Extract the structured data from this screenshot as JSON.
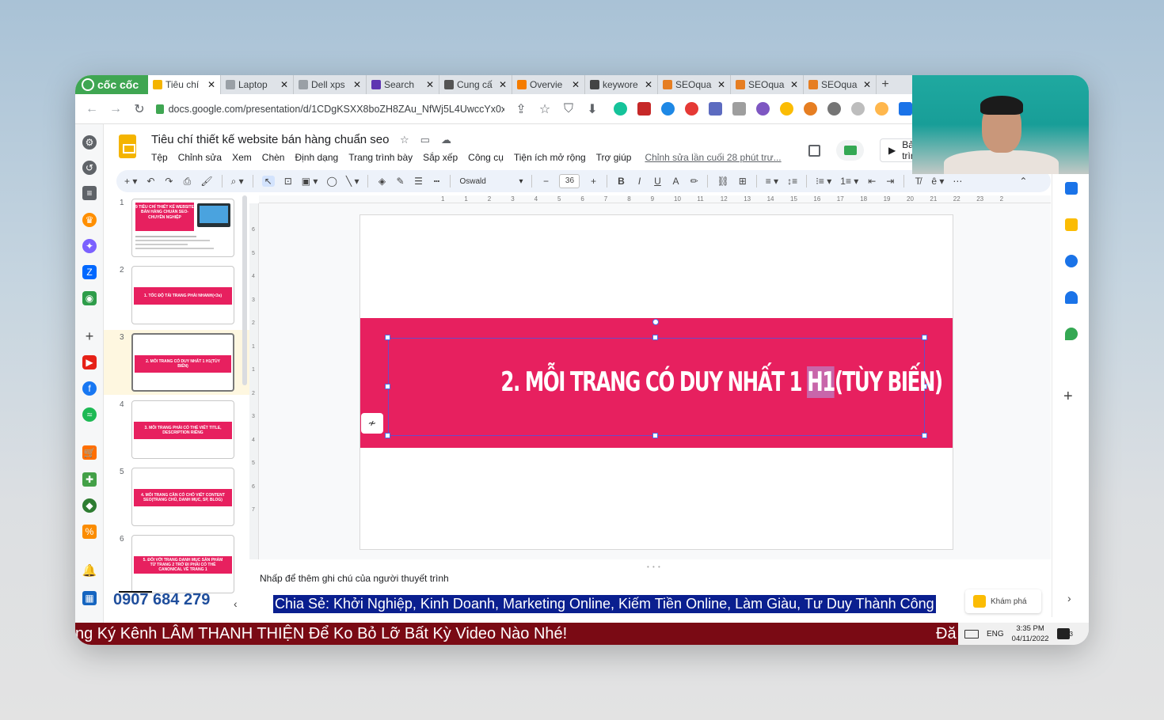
{
  "browser": {
    "brand": "cốc cốc",
    "tabs": [
      {
        "label": "Tiêu chí",
        "icon": "slides-icon",
        "color": "#f4b400",
        "active": true
      },
      {
        "label": "Laptop",
        "icon": "globe-icon",
        "color": "#9aa0a6"
      },
      {
        "label": "Dell xps",
        "icon": "globe-icon",
        "color": "#9aa0a6"
      },
      {
        "label": "Search",
        "icon": "search-console-icon",
        "color": "#5e35b1"
      },
      {
        "label": "Cung cấ",
        "icon": "bing-icon",
        "color": "#555555"
      },
      {
        "label": "Overvie",
        "icon": "ahrefs-icon",
        "color": "#f57c00"
      },
      {
        "label": "keywore",
        "icon": "globe-icon",
        "color": "#444444"
      },
      {
        "label": "SEOqua",
        "icon": "seoquake-icon",
        "color": "#e67e22"
      },
      {
        "label": "SEOqua",
        "icon": "seoquake-icon",
        "color": "#e67e22"
      },
      {
        "label": "SEOqua",
        "icon": "seoquake-icon",
        "color": "#e67e22"
      }
    ],
    "url": "docs.google.com/presentation/d/1CDgKSXX8boZH8ZAu_NfWj5L4UwccYx0xP..."
  },
  "doc": {
    "title": "Tiêu chí thiết kế website bán hàng chuẩn seo",
    "menu": [
      "Tệp",
      "Chỉnh sửa",
      "Xem",
      "Chèn",
      "Định dạng",
      "Trang trình bày",
      "Sắp xếp",
      "Công cụ",
      "Tiện ích mở rộng",
      "Trợ giúp"
    ],
    "last_edit": "Chỉnh sửa lần cuối 28 phút trư...",
    "present_label": "Bản trìn"
  },
  "toolbar": {
    "font": "Oswald",
    "font_size": "36"
  },
  "rulers": {
    "h": [
      "1",
      "1",
      "2",
      "3",
      "4",
      "5",
      "6",
      "7",
      "8",
      "9",
      "10",
      "11",
      "12",
      "13",
      "14",
      "15",
      "16",
      "17",
      "18",
      "19",
      "20",
      "21",
      "22",
      "23",
      "2"
    ],
    "v": [
      "6",
      "5",
      "4",
      "3",
      "2",
      "1",
      "1",
      "2",
      "3",
      "4",
      "5",
      "6",
      "7"
    ]
  },
  "slides": [
    {
      "num": "1",
      "text": "9 TIÊU CHÍ THIẾT KẾ WEBSITE BÁN HÀNG CHUẨN SEO-CHUYÊN NGHIỆP"
    },
    {
      "num": "2",
      "text": "1. TỐC ĐỘ TẢI TRANG PHẢI NHANH(<3s)"
    },
    {
      "num": "3",
      "text": "2. MỖI TRANG CÓ DUY NHẤT 1 H1(TÙY BIẾN)"
    },
    {
      "num": "4",
      "text": "3. MỖI TRANG PHẢI CÓ THẺ VIẾT TITLE, DESCRIPTION RIÊNG"
    },
    {
      "num": "5",
      "text": "4. MỖI TRANG CẦN CÓ CHỖ VIẾT CONTENT SEO(TRANG CHỦ, DANH MỤC, SP, BLOG)"
    },
    {
      "num": "6",
      "text": "5. ĐỐI VỚI TRANG DANH MỤC SẢN PHẨM TỪ TRANG 2 TRỞ ĐI PHẢI CÓ THẺ CANONICAL VỀ TRANG 1"
    }
  ],
  "current_slide": {
    "title_pre": "2. MỖI TRANG CÓ DUY NHẤT 1 ",
    "title_hl": "H1",
    "title_post": "(TÙY BIẾN)",
    "band_color": "#e7205f"
  },
  "notes_placeholder": "Nhấp để thêm ghi chú của người thuyết trình",
  "overlays": {
    "phone": "0907 684 279",
    "top_marquee": "Chia Sẻ: Khởi Nghiệp, Kinh Doanh, Marketing Online, Kiếm Tiền Online, Làm Giàu, Tư Duy Thành Công",
    "bottom_marquee": "ng Ký Kênh LÂM THANH THIỆN Để Ko Bỏ Lỡ Bất Kỳ Video Nào Nhé!",
    "bottom_marquee_tail": "Đă",
    "explore_label": "Khám phá"
  },
  "taskbar": {
    "lang": "ENG",
    "time": "3:35 PM",
    "date": "04/11/2022",
    "notif_count": "3"
  }
}
